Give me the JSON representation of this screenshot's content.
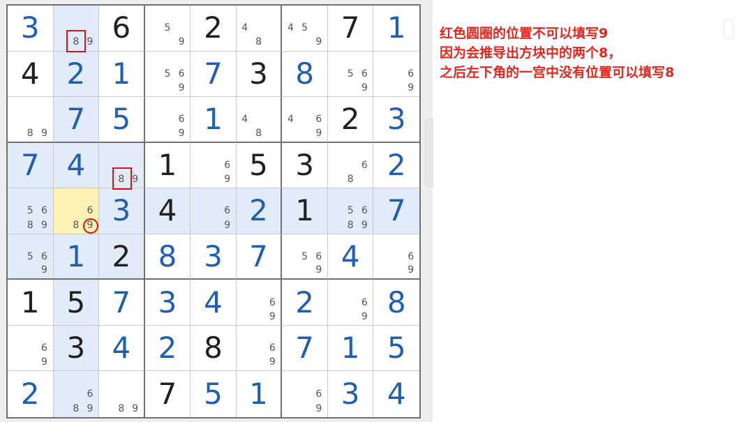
{
  "board": {
    "cells": [
      [
        {
          "v": "3",
          "t": "user"
        },
        {
          "n": [
            8,
            9
          ]
        },
        {
          "v": "6",
          "t": "given"
        },
        {
          "n": [
            5,
            9
          ]
        },
        {
          "v": "2",
          "t": "given"
        },
        {
          "n": [
            4,
            8
          ]
        },
        {
          "n": [
            4,
            5,
            9
          ]
        },
        {
          "v": "7",
          "t": "given"
        },
        {
          "v": "1",
          "t": "user"
        }
      ],
      [
        {
          "v": "4",
          "t": "given"
        },
        {
          "v": "2",
          "t": "user"
        },
        {
          "v": "1",
          "t": "user"
        },
        {
          "n": [
            5,
            6,
            9
          ]
        },
        {
          "v": "7",
          "t": "user"
        },
        {
          "v": "3",
          "t": "given"
        },
        {
          "v": "8",
          "t": "user"
        },
        {
          "n": [
            5,
            6,
            9
          ]
        },
        {
          "n": [
            6,
            9
          ]
        }
      ],
      [
        {
          "n": [
            8,
            9
          ]
        },
        {
          "v": "7",
          "t": "user"
        },
        {
          "v": "5",
          "t": "user"
        },
        {
          "n": [
            6,
            9
          ]
        },
        {
          "v": "1",
          "t": "user"
        },
        {
          "n": [
            4,
            8
          ]
        },
        {
          "n": [
            4,
            6,
            9
          ]
        },
        {
          "v": "2",
          "t": "given"
        },
        {
          "v": "3",
          "t": "user"
        }
      ],
      [
        {
          "v": "7",
          "t": "user"
        },
        {
          "v": "4",
          "t": "user"
        },
        {
          "n": [
            8,
            9
          ]
        },
        {
          "v": "1",
          "t": "given"
        },
        {
          "n": [
            6,
            9
          ]
        },
        {
          "v": "5",
          "t": "given"
        },
        {
          "v": "3",
          "t": "given"
        },
        {
          "n": [
            6,
            8
          ]
        },
        {
          "v": "2",
          "t": "user"
        }
      ],
      [
        {
          "n": [
            5,
            6,
            8,
            9
          ]
        },
        {
          "n": [
            6,
            8,
            9
          ]
        },
        {
          "v": "3",
          "t": "user"
        },
        {
          "v": "4",
          "t": "given"
        },
        {
          "n": [
            6,
            9
          ]
        },
        {
          "v": "2",
          "t": "user"
        },
        {
          "v": "1",
          "t": "given"
        },
        {
          "n": [
            5,
            6,
            8,
            9
          ]
        },
        {
          "v": "7",
          "t": "user"
        }
      ],
      [
        {
          "n": [
            5,
            6,
            9
          ]
        },
        {
          "v": "1",
          "t": "user"
        },
        {
          "v": "2",
          "t": "given"
        },
        {
          "v": "8",
          "t": "user"
        },
        {
          "v": "3",
          "t": "user"
        },
        {
          "v": "7",
          "t": "user"
        },
        {
          "n": [
            5,
            6,
            9
          ]
        },
        {
          "v": "4",
          "t": "user"
        },
        {
          "n": [
            6,
            9
          ]
        }
      ],
      [
        {
          "v": "1",
          "t": "given"
        },
        {
          "v": "5",
          "t": "given"
        },
        {
          "v": "7",
          "t": "user"
        },
        {
          "v": "3",
          "t": "user"
        },
        {
          "v": "4",
          "t": "user"
        },
        {
          "n": [
            6,
            9
          ]
        },
        {
          "v": "2",
          "t": "user"
        },
        {
          "n": [
            6,
            9
          ]
        },
        {
          "v": "8",
          "t": "user"
        }
      ],
      [
        {
          "n": [
            6,
            9
          ]
        },
        {
          "v": "3",
          "t": "given"
        },
        {
          "v": "4",
          "t": "user"
        },
        {
          "v": "2",
          "t": "user"
        },
        {
          "v": "8",
          "t": "given"
        },
        {
          "n": [
            6,
            9
          ]
        },
        {
          "v": "7",
          "t": "user"
        },
        {
          "v": "1",
          "t": "user"
        },
        {
          "v": "5",
          "t": "user"
        }
      ],
      [
        {
          "v": "2",
          "t": "user"
        },
        {
          "n": [
            6,
            8,
            9
          ]
        },
        {
          "n": [
            8,
            9
          ]
        },
        {
          "v": "7",
          "t": "given"
        },
        {
          "v": "5",
          "t": "user"
        },
        {
          "v": "1",
          "t": "user"
        },
        {
          "n": [
            6,
            9
          ]
        },
        {
          "v": "3",
          "t": "user"
        },
        {
          "v": "4",
          "t": "user"
        }
      ]
    ],
    "selected": [
      4,
      1
    ],
    "highlight_color": "#e2ebf9",
    "selected_color": "#fbf2b4",
    "given_color": "#202020",
    "user_color": "#1e5fb5",
    "marks": [
      {
        "type": "box",
        "row": 0,
        "col": 1,
        "digit": 8
      },
      {
        "type": "box",
        "row": 3,
        "col": 2,
        "digit": 8
      },
      {
        "type": "circle",
        "row": 4,
        "col": 1,
        "digit": 9
      }
    ],
    "mark_color": "#e01010"
  },
  "explanation": {
    "lines": [
      "红色圆圈的位置不可以填写9",
      "因为会推导出方块中的两个8，",
      "之后左下角的一宫中没有位置可以填写8"
    ],
    "color": "#e8241c"
  }
}
